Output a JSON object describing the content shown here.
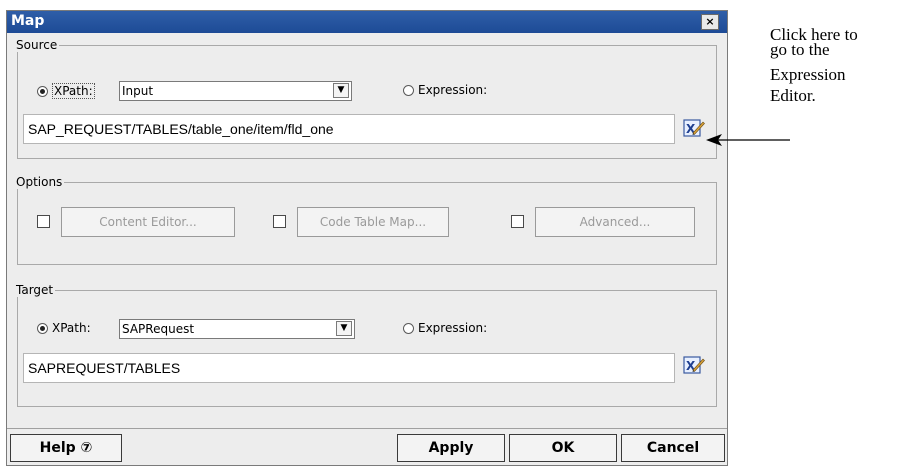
{
  "dialog": {
    "title": "Map",
    "close_glyph": "×"
  },
  "source": {
    "legend": "Source",
    "xpath_label": "XPath:",
    "xpath_value": "Input",
    "expression_label": "Expression:",
    "path": "SAP_REQUEST/TABLES/table_one/item/fld_one",
    "selected": "xpath"
  },
  "options": {
    "legend": "Options",
    "buttons": [
      "Content Editor...",
      "Code Table Map...",
      "Advanced..."
    ]
  },
  "target": {
    "legend": "Target",
    "xpath_label": "XPath:",
    "xpath_value": "SAPRequest",
    "expression_label": "Expression:",
    "path": "SAPREQUEST/TABLES",
    "selected": "xpath"
  },
  "footer": {
    "help": "Help ⑦",
    "apply": "Apply",
    "ok": "OK",
    "cancel": "Cancel"
  },
  "annotation": {
    "lines": [
      "Click here to",
      "go to the",
      "Expression",
      "Editor."
    ]
  },
  "icons": {
    "dropdown": "chevron-down-icon",
    "expression_editor": "expression-editor-icon"
  },
  "colors": {
    "title_bar": "#1d4b96",
    "dialog_bg": "#ededed"
  }
}
